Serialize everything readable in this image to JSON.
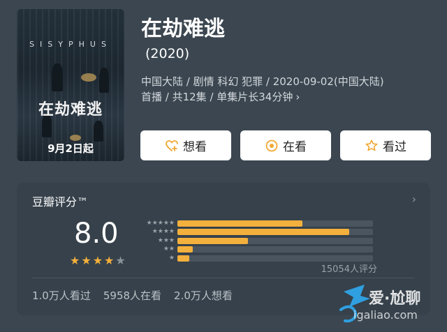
{
  "poster": {
    "en_title": "SISYPHUS",
    "cn_title": "在劫难逃",
    "premiere_caption": "9月2日起"
  },
  "title": "在劫难逃",
  "year": "(2020)",
  "meta": {
    "line1": "中国大陆 / 剧情 科幻 犯罪 / 2020-09-02(中国大陆)",
    "line2": "首播 / 共12集 / 单集片长34分钟",
    "chevron_icon": "chevron-right-icon"
  },
  "actions": [
    {
      "label": "想看",
      "icon": "heart-plus-icon",
      "color": "#f0a834"
    },
    {
      "label": "在看",
      "icon": "target-dot-icon",
      "color": "#f0a834"
    },
    {
      "label": "看过",
      "icon": "star-outline-icon",
      "color": "#f0a834"
    }
  ],
  "rating": {
    "label": "豆瓣评分™",
    "score": "8.0",
    "stars_filled": 4,
    "stars_total": 5,
    "accent": "#f4b03c",
    "distribution": [
      {
        "stars": 5,
        "share": 0.32
      },
      {
        "stars": 4,
        "share": 0.44
      },
      {
        "stars": 3,
        "share": 0.18
      },
      {
        "stars": 2,
        "share": 0.04
      },
      {
        "stars": 1,
        "share": 0.03
      }
    ],
    "count_label": "15054人评分"
  },
  "stats": {
    "watched": "1.0万人看过",
    "watching": "5958人在看",
    "want": "2.0万人想看"
  },
  "watermark": {
    "line1": "爱·尬聊",
    "line2": "igaliao.com"
  }
}
